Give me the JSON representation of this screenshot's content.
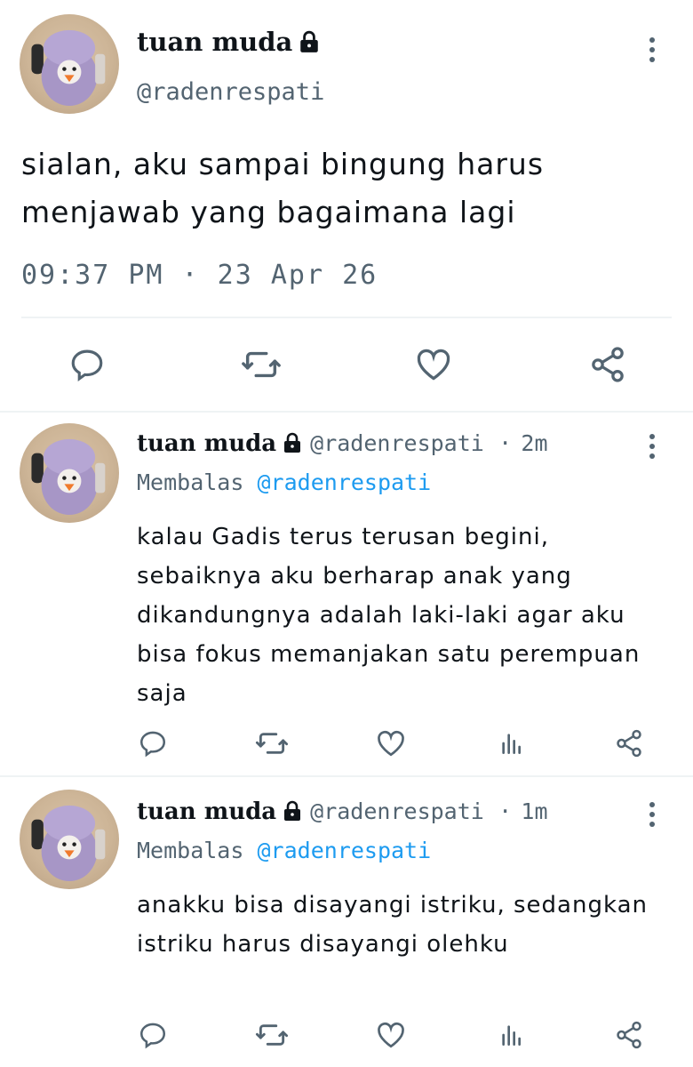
{
  "main_tweet": {
    "display_name": "tuan muda",
    "handle": "@radenrespati",
    "text": "sialan, aku sampai bingung harus menjawab yang bagaimana lagi",
    "timestamp": "09:37 PM · 23 Apr 26"
  },
  "replies": [
    {
      "display_name": "tuan muda",
      "handle": "@radenrespati",
      "time_ago": "2m",
      "replying_prefix": "Membalas",
      "replying_to": "@radenrespati",
      "text": "kalau Gadis terus terusan begini, sebaiknya aku berharap anak yang dikandungnya adalah laki-laki agar aku bisa fokus memanjakan satu perempuan saja"
    },
    {
      "display_name": "tuan muda",
      "handle": "@radenrespati",
      "time_ago": "1m",
      "replying_prefix": "Membalas",
      "replying_to": "@radenrespati",
      "text": "anakku bisa disayangi istriku, sedangkan istriku harus disayangi olehku"
    }
  ],
  "separator": "·",
  "colors": {
    "text_primary": "#0f1419",
    "text_secondary": "#536471",
    "accent": "#1d9bf0",
    "divider": "#eff3f4"
  },
  "icons": [
    "reply-icon",
    "retweet-icon",
    "like-icon",
    "views-icon",
    "share-icon",
    "lock-icon",
    "more-icon"
  ]
}
